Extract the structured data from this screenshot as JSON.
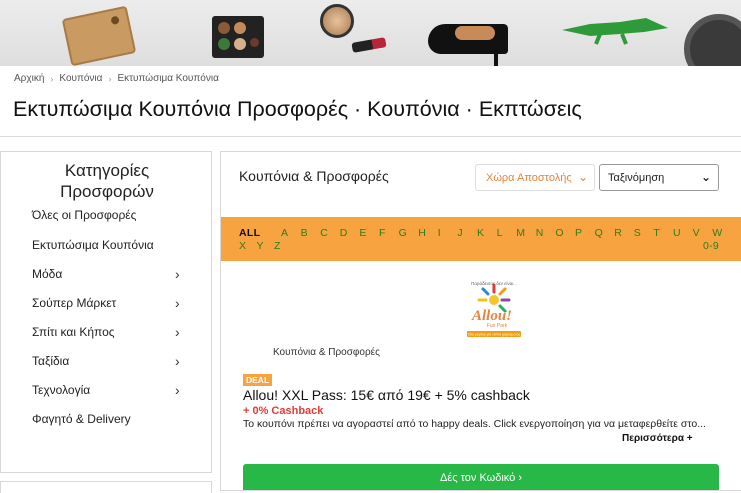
{
  "breadcrumb": [
    "Αρχική",
    "Κουπόνια",
    "Εκτυπώσιμα Κουπόνια"
  ],
  "breadcrumb_sep": "›",
  "page_title": "Εκτυπώσιμα Κουπόνια Προσφορές · Κουπόνια · Εκπτώσεις",
  "sidebar": {
    "heading": "Κατηγορίες Προσφορών",
    "items": [
      {
        "label": "Όλες οι Προσφορές",
        "chevron": ""
      },
      {
        "label": "Εκτυπώσιμα Κουπόνια",
        "chevron": ""
      },
      {
        "label": "Μόδα",
        "chevron": "›"
      },
      {
        "label": "Σούπερ Μάρκετ",
        "chevron": "›"
      },
      {
        "label": "Σπίτι και Κήπος",
        "chevron": "›"
      },
      {
        "label": "Ταξίδια",
        "chevron": "›"
      },
      {
        "label": "Τεχνολογία",
        "chevron": "›"
      },
      {
        "label": "Φαγητό & Delivery",
        "chevron": ""
      }
    ]
  },
  "main": {
    "heading": "Κουπόνια & Προσφορές",
    "country_select": "Χώρα Αποστολής",
    "sort_select": "Ταξινόμηση",
    "letters_row1": [
      "ALL",
      "A",
      "B",
      "C",
      "D",
      "E",
      "F",
      "G",
      "H",
      "I",
      "J",
      "K",
      "L",
      "M",
      "N",
      "O",
      "P",
      "Q",
      "R",
      "S",
      "T",
      "U",
      "V",
      "W"
    ],
    "letters_row2": [
      "X",
      "Y",
      "Z"
    ],
    "letters_extra": "0-9"
  },
  "deal": {
    "logo_brand": "Allou!",
    "logo_sub": "Fun Park",
    "logo_top": "Παράδεισος δεν είναι...",
    "logo_tag": "Όλα μεγάλα για να'σαι χαρούμενος",
    "category": "Κουπόνια & Προσφορές",
    "badge": "DEAL",
    "title": "Allou! XXL Pass: 15€ από 19€ + 5% cashback",
    "cashback": "+ 0% Cashback",
    "description": "Το κουπόνι πρέπει να αγοραστεί από το happy deals. Click ενεργοποίηση για να μεταφερθείτε στο...",
    "more_label": "Περισσότερα +",
    "button_label": "Δές τον Κωδικό ›"
  },
  "colors": {
    "accent_orange": "#f7a440",
    "letter_green": "#2e7d20",
    "button_green": "#27b847",
    "cashback_red": "#e53935"
  },
  "icons": {
    "breadcrumb_sep": "chevron-right-icon",
    "sidebar_chevron": "chevron-right-icon",
    "select_chevron": "chevron-down-icon"
  }
}
